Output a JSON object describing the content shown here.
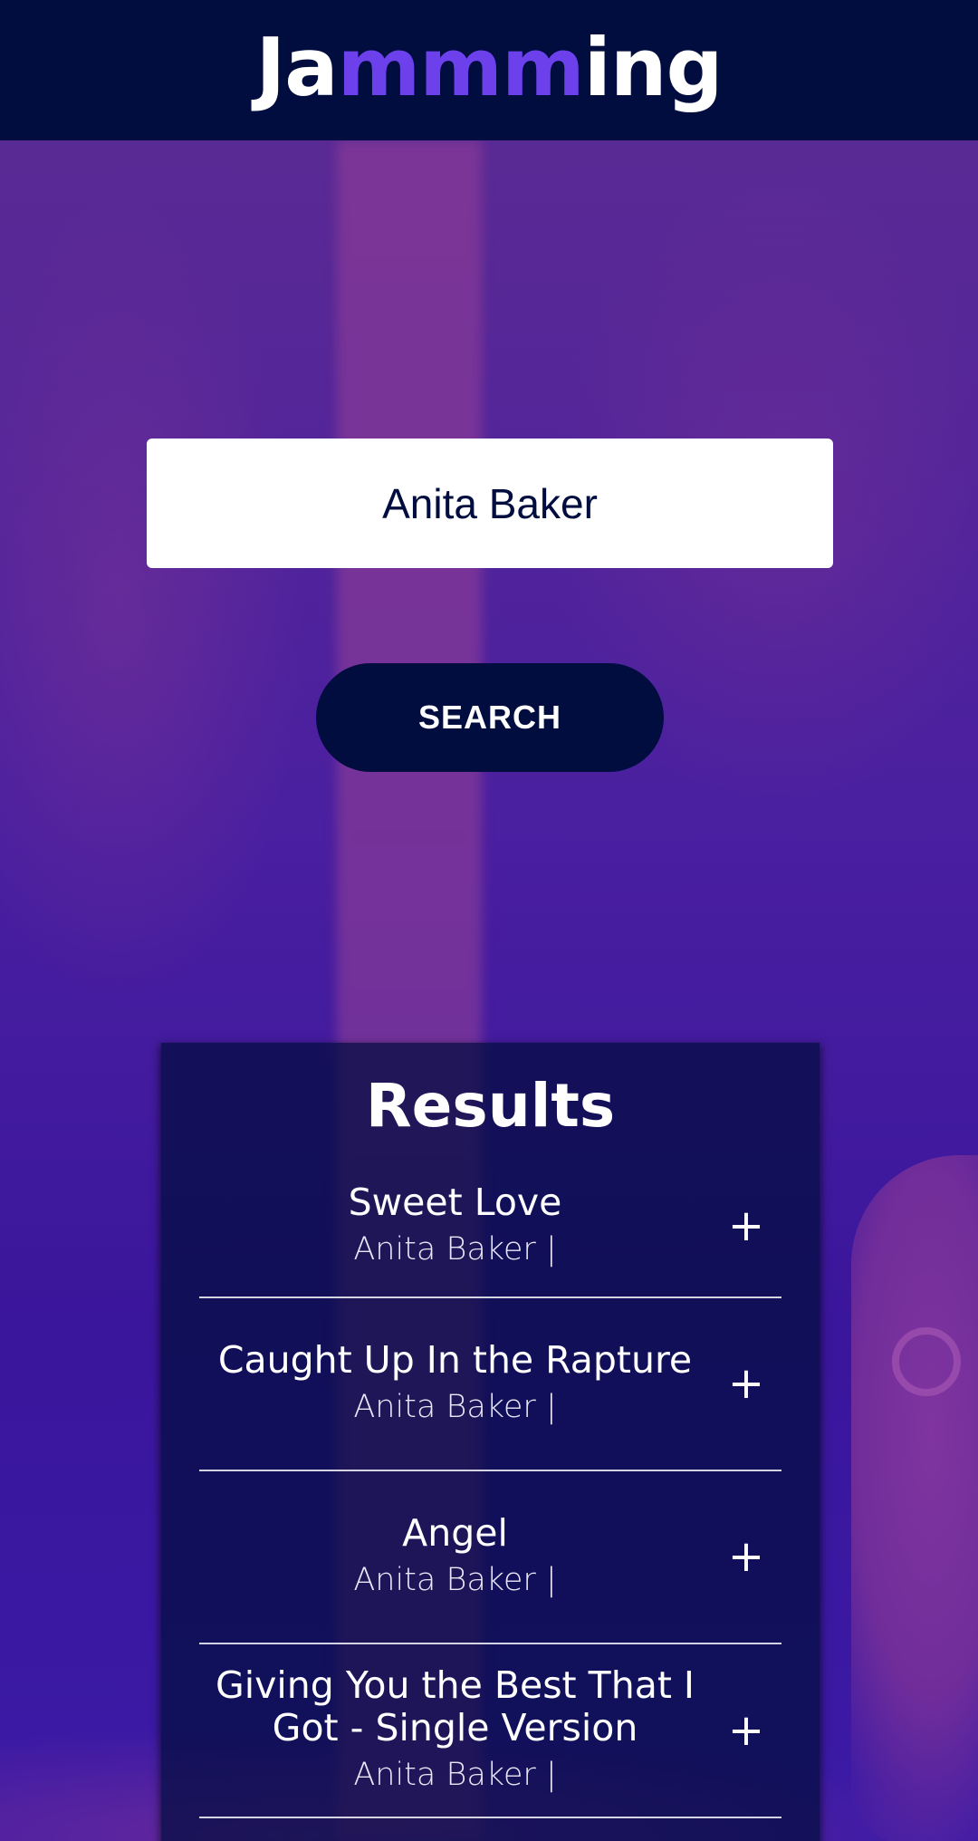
{
  "app": {
    "logo_prefix": "Ja",
    "logo_accent": "mmm",
    "logo_suffix": "ing",
    "colors": {
      "header_bg": "#010c3f",
      "accent": "#6c41ec",
      "background": "#3c1a9c"
    }
  },
  "search": {
    "value": "Anita Baker",
    "button_label": "SEARCH"
  },
  "results": {
    "title": "Results",
    "tracks": [
      {
        "name": "Sweet Love",
        "artist": "Anita Baker |",
        "action": "+"
      },
      {
        "name": "Caught Up In the Rapture",
        "artist": "Anita Baker |",
        "action": "+"
      },
      {
        "name": "Angel",
        "artist": "Anita Baker |",
        "action": "+"
      },
      {
        "name": "Giving You the Best That I Got - Single Version",
        "artist": "Anita Baker |",
        "action": "+"
      }
    ]
  }
}
